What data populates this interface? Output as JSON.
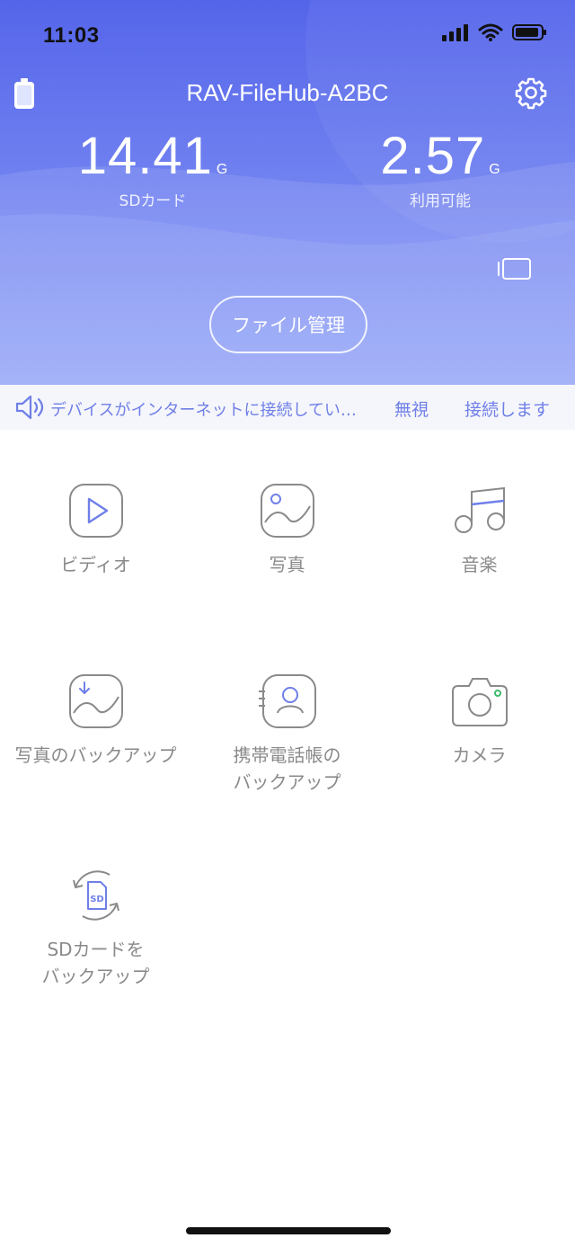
{
  "status_bar": {
    "time": "11:03"
  },
  "header": {
    "device_name": "RAV-FileHub-A2BC",
    "sd_card": {
      "value": "14.41",
      "unit": "G",
      "label": "SDカード"
    },
    "available": {
      "value": "2.57",
      "unit": "G",
      "label": "利用可能"
    },
    "file_manage_label": "ファイル管理"
  },
  "notice": {
    "text": "デバイスがインターネットに接続してい…",
    "ignore_label": "無視",
    "connect_label": "接続します"
  },
  "grid": {
    "items": [
      {
        "label": "ビディオ",
        "icon": "video-play-icon"
      },
      {
        "label": "写真",
        "icon": "photo-icon"
      },
      {
        "label": "音楽",
        "icon": "music-icon"
      },
      {
        "label": "写真のバックアップ",
        "icon": "photo-backup-icon"
      },
      {
        "label": "携帯電話帳の\nバックアップ",
        "icon": "contacts-backup-icon"
      },
      {
        "label": "カメラ",
        "icon": "camera-icon"
      },
      {
        "label": "SDカードを\nバックアップ",
        "icon": "sd-backup-icon"
      }
    ]
  },
  "colors": {
    "accent": "#6f7fe8",
    "header_top": "#5565ea",
    "header_bottom": "#93a4f8",
    "icon_gray": "#8a8a8a"
  }
}
